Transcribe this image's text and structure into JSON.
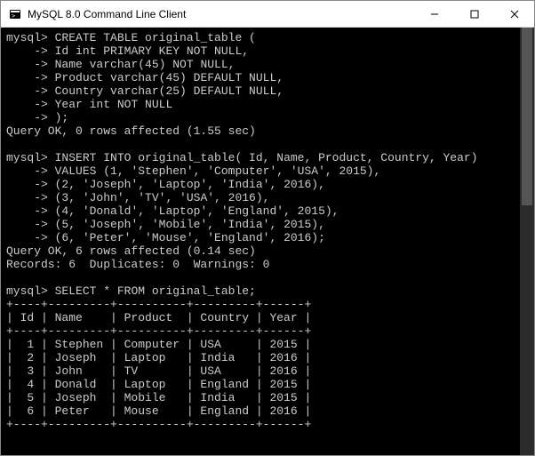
{
  "window": {
    "title": "MySQL 8.0 Command Line Client"
  },
  "terminal": {
    "prompt": "mysql>",
    "cont": "    ->",
    "create_table": {
      "l1": "CREATE TABLE original_table (",
      "l2": "Id int PRIMARY KEY NOT NULL,",
      "l3": "Name varchar(45) NOT NULL,",
      "l4": "Product varchar(45) DEFAULT NULL,",
      "l5": "Country varchar(25) DEFAULT NULL,",
      "l6": "Year int NOT NULL",
      "l7": ");",
      "result": "Query OK, 0 rows affected (1.55 sec)"
    },
    "insert": {
      "l1": "INSERT INTO original_table( Id, Name, Product, Country, Year)",
      "l2": "VALUES (1, 'Stephen', 'Computer', 'USA', 2015),",
      "l3": "(2, 'Joseph', 'Laptop', 'India', 2016),",
      "l4": "(3, 'John', 'TV', 'USA', 2016),",
      "l5": "(4, 'Donald', 'Laptop', 'England', 2015),",
      "l6": "(5, 'Joseph', 'Mobile', 'India', 2015),",
      "l7": "(6, 'Peter', 'Mouse', 'England', 2016);",
      "result1": "Query OK, 6 rows affected (0.14 sec)",
      "result2": "Records: 6  Duplicates: 0  Warnings: 0"
    },
    "select": {
      "query": "SELECT * FROM original_table;",
      "sep": "+----+---------+----------+---------+------+",
      "header": "| Id | Name    | Product  | Country | Year |",
      "rows": [
        "|  1 | Stephen | Computer | USA     | 2015 |",
        "|  2 | Joseph  | Laptop   | India   | 2016 |",
        "|  3 | John    | TV       | USA     | 2016 |",
        "|  4 | Donald  | Laptop   | England | 2015 |",
        "|  5 | Joseph  | Mobile   | India   | 2015 |",
        "|  6 | Peter   | Mouse    | England | 2016 |"
      ]
    }
  },
  "chart_data": {
    "type": "table",
    "columns": [
      "Id",
      "Name",
      "Product",
      "Country",
      "Year"
    ],
    "rows": [
      [
        1,
        "Stephen",
        "Computer",
        "USA",
        2015
      ],
      [
        2,
        "Joseph",
        "Laptop",
        "India",
        2016
      ],
      [
        3,
        "John",
        "TV",
        "USA",
        2016
      ],
      [
        4,
        "Donald",
        "Laptop",
        "England",
        2015
      ],
      [
        5,
        "Joseph",
        "Mobile",
        "India",
        2015
      ],
      [
        6,
        "Peter",
        "Mouse",
        "England",
        2016
      ]
    ]
  }
}
